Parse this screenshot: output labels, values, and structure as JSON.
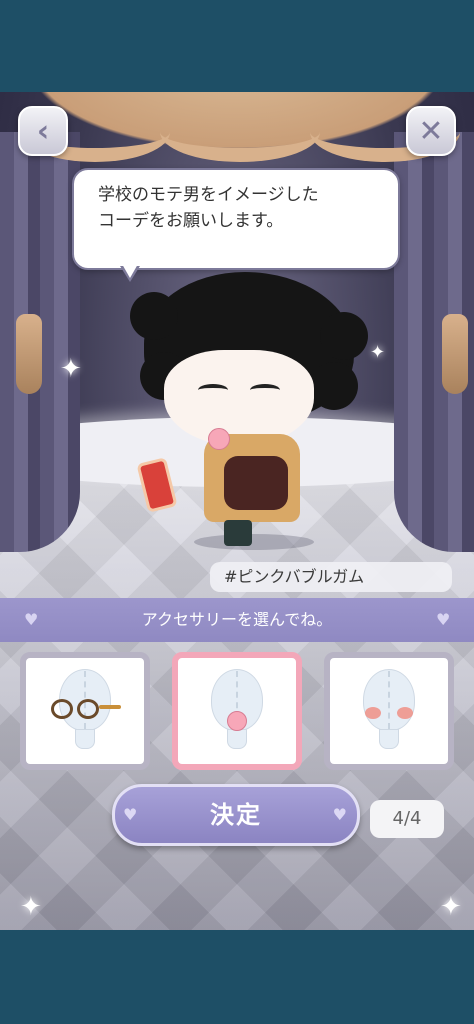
{
  "speech": {
    "line1": "学校のモテ男をイメージした",
    "line2": "コーデをお願いします。"
  },
  "hashtag": "#ピンクバブルガム",
  "instruction": "アクセサリーを選んでね。",
  "choices": [
    {
      "item": "round-glasses",
      "selected": false
    },
    {
      "item": "pink-bubble-gum",
      "selected": true
    },
    {
      "item": "cheek-blush",
      "selected": false
    }
  ],
  "decide_button": "決定",
  "page_count": "4/4",
  "icons": {
    "back": "back-chevron-icon",
    "close": "close-x-icon",
    "heart": "heart-icon"
  },
  "colors": {
    "frame": "#1e4f66",
    "accent_purple": "#8f89c2",
    "selected_border": "#f3a7b9"
  }
}
